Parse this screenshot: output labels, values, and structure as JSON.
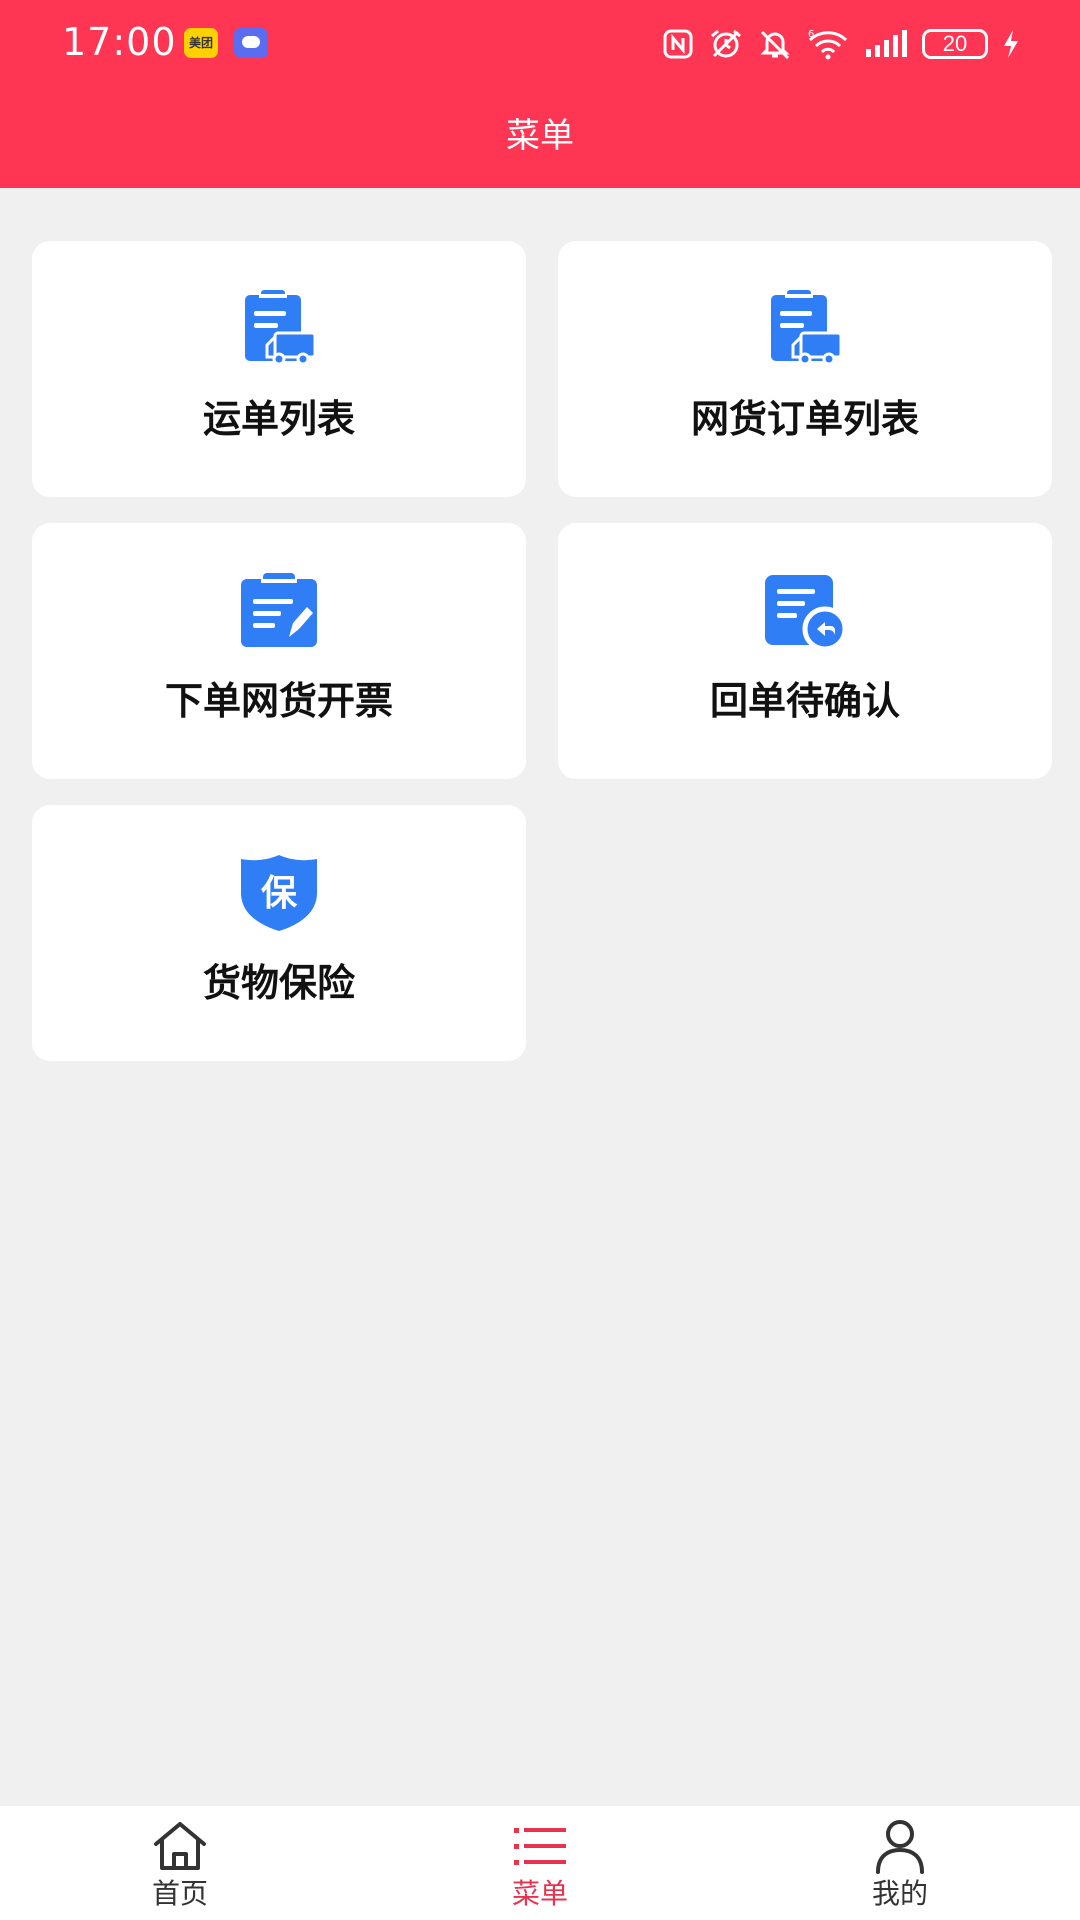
{
  "status_bar": {
    "time": "17:00",
    "meituan_badge": "美团",
    "battery": "20",
    "icons": [
      "meituan-icon",
      "message-icon",
      "nfc-icon",
      "alarm-icon",
      "mute-icon",
      "wifi-icon",
      "signal-icon",
      "battery-icon",
      "charging-icon"
    ]
  },
  "header": {
    "title": "菜单"
  },
  "menu": {
    "items": [
      {
        "label": "运单列表",
        "icon": "waybill-truck-icon"
      },
      {
        "label": "网货订单列表",
        "icon": "waybill-truck-icon"
      },
      {
        "label": "下单网货开票",
        "icon": "invoice-edit-icon"
      },
      {
        "label": "回单待确认",
        "icon": "receipt-return-icon"
      },
      {
        "label": "货物保险",
        "icon": "insurance-shield-icon"
      }
    ]
  },
  "tabbar": {
    "items": [
      {
        "label": "首页",
        "icon": "home-icon",
        "active": false
      },
      {
        "label": "菜单",
        "icon": "menu-list-icon",
        "active": true
      },
      {
        "label": "我的",
        "icon": "user-icon",
        "active": false
      }
    ]
  },
  "colors": {
    "header_bg": "#fe3654",
    "page_bg": "#f0f0f0",
    "icon_blue": "#2f7ef5",
    "tab_active": "#e8334f",
    "tab_inactive": "#333333"
  }
}
